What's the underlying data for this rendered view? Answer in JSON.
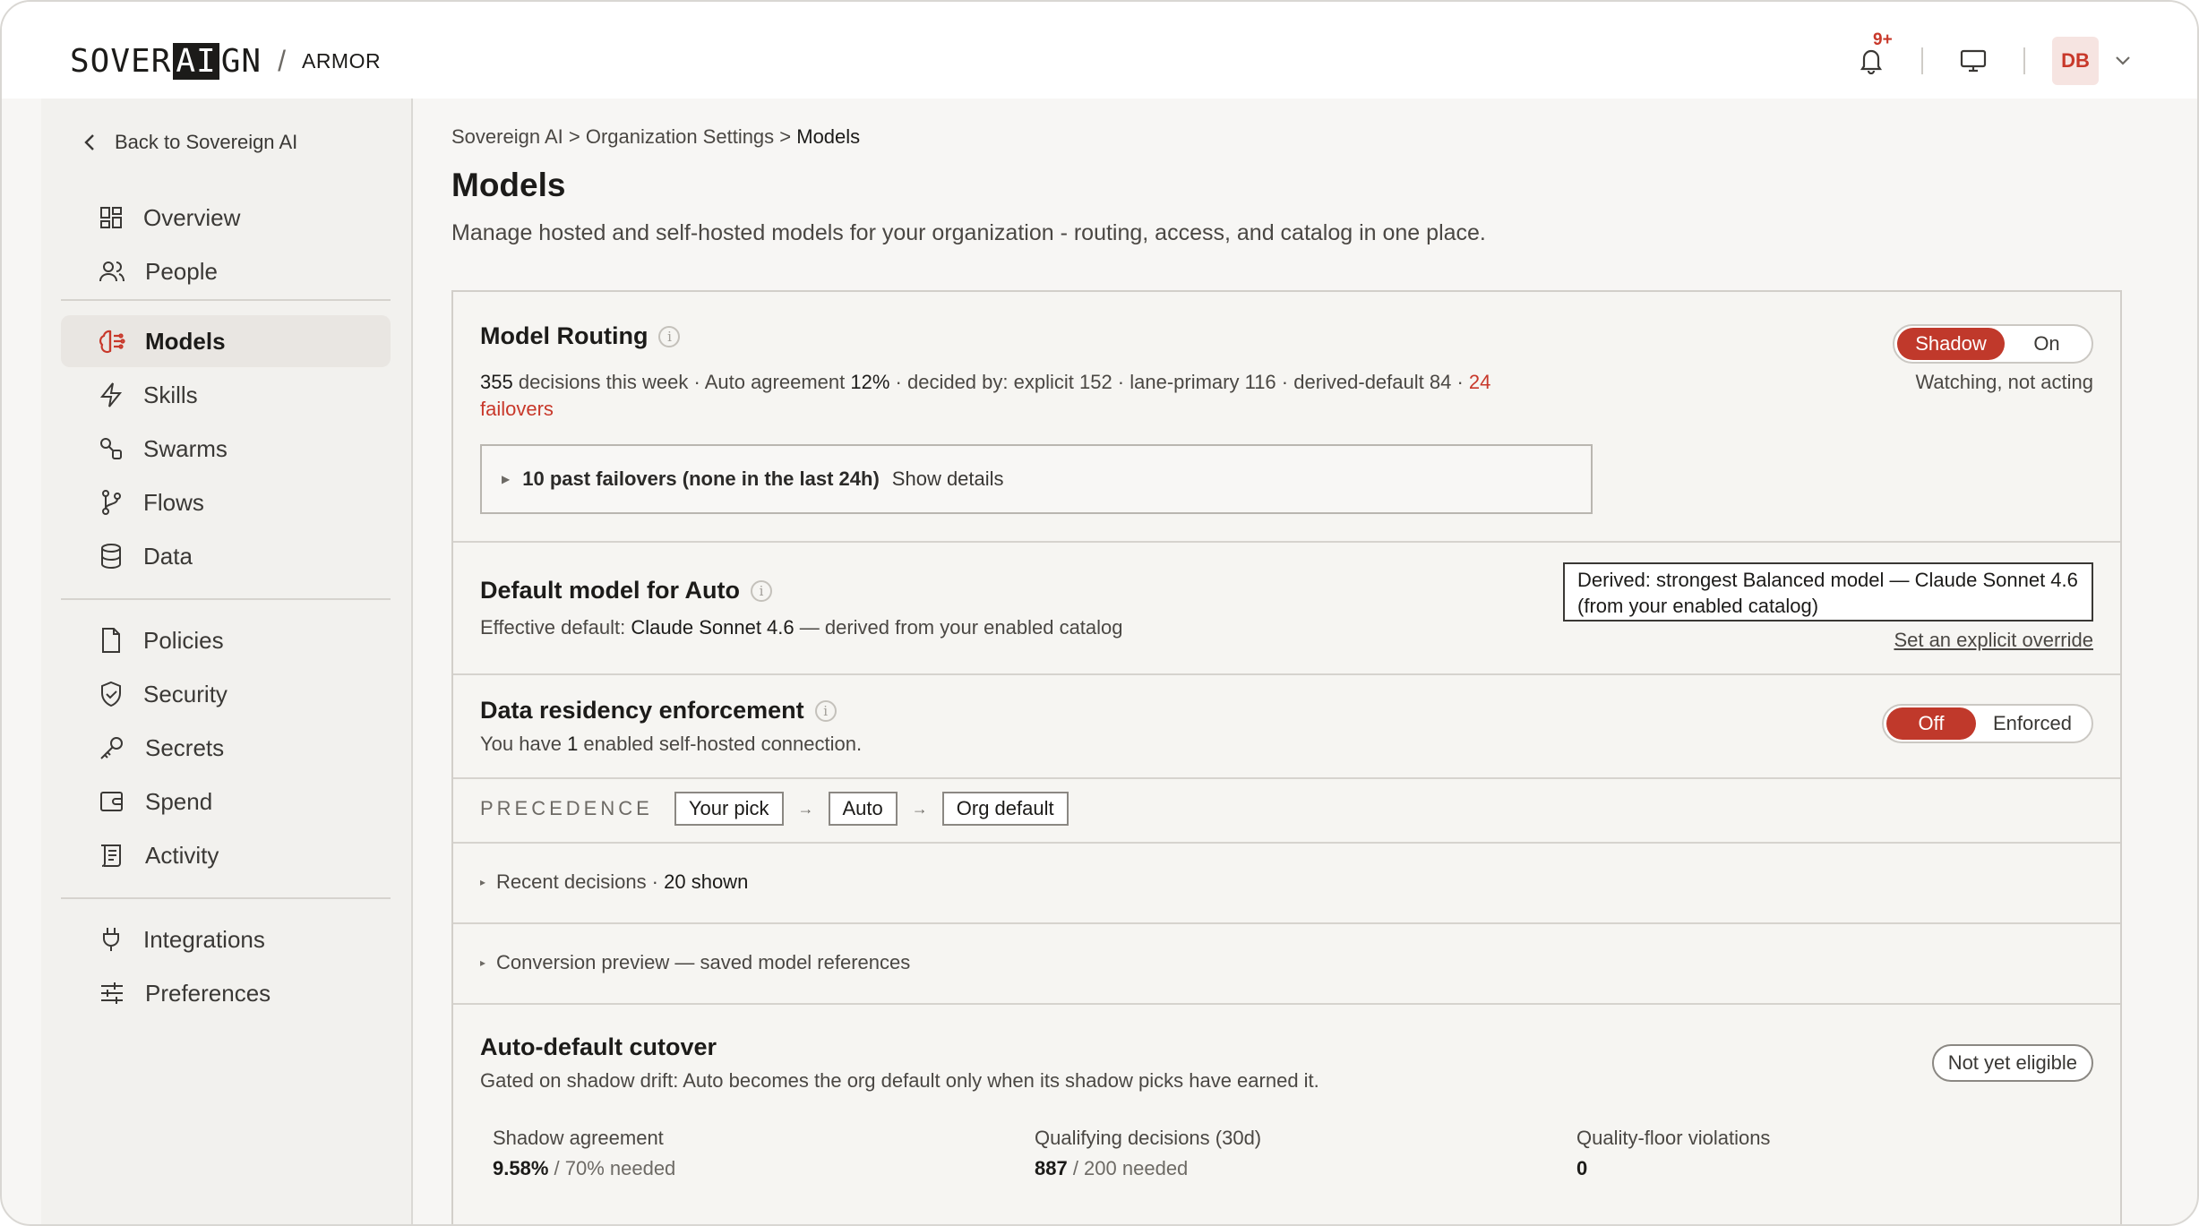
{
  "brand": {
    "logo_pre": "SOVER",
    "logo_ai": "AI",
    "logo_post": "GN",
    "separator": "/",
    "product": "ARMOR"
  },
  "header": {
    "notifications_badge": "9+",
    "avatar_initials": "DB"
  },
  "sidebar": {
    "back_label": "Back to Sovereign AI",
    "items": [
      {
        "label": "Overview",
        "icon": "grid-icon"
      },
      {
        "label": "People",
        "icon": "users-icon"
      },
      {
        "label": "Models",
        "icon": "brain-icon",
        "active": true
      },
      {
        "label": "Skills",
        "icon": "bolt-icon"
      },
      {
        "label": "Swarms",
        "icon": "nodes-icon"
      },
      {
        "label": "Flows",
        "icon": "branch-icon"
      },
      {
        "label": "Data",
        "icon": "database-icon"
      },
      {
        "label": "Policies",
        "icon": "document-icon"
      },
      {
        "label": "Security",
        "icon": "shield-icon"
      },
      {
        "label": "Secrets",
        "icon": "key-icon"
      },
      {
        "label": "Spend",
        "icon": "wallet-icon"
      },
      {
        "label": "Activity",
        "icon": "scroll-icon"
      },
      {
        "label": "Integrations",
        "icon": "plug-icon"
      },
      {
        "label": "Preferences",
        "icon": "sliders-icon"
      }
    ]
  },
  "breadcrumb": {
    "root": "Sovereign AI",
    "parent": "Organization Settings",
    "current": "Models",
    "sep": " > "
  },
  "page": {
    "title": "Models",
    "subtitle": "Manage hosted and self-hosted models for your organization - routing, access, and catalog in one place."
  },
  "routing": {
    "title": "Model Routing",
    "decisions_count": "355",
    "decisions_text": " decisions this week · Auto agreement ",
    "agreement": "12%",
    "decided_by": " · decided by: explicit 152 · lane-primary 116 · derived-default 84 · ",
    "failovers_count": "24",
    "failovers_word": "failovers",
    "toggle_shadow": "Shadow",
    "toggle_on": "On",
    "mode_caption": "Watching, not acting",
    "past_failovers": "10 past failovers (none in the last 24h)",
    "show_details": "Show details"
  },
  "default_model": {
    "title": "Default model for Auto",
    "effective_prefix": "Effective default: ",
    "effective_model": "Claude Sonnet 4.6",
    "effective_suffix": " — derived from your enabled catalog",
    "derived_text": "Derived: strongest Balanced model — Claude Sonnet 4.6 (from your enabled catalog)",
    "override_link": "Set an explicit override"
  },
  "residency": {
    "title": "Data residency enforcement",
    "text_prefix": "You have ",
    "count": "1",
    "text_suffix": " enabled self-hosted connection.",
    "toggle_off": "Off",
    "toggle_enforced": "Enforced"
  },
  "precedence": {
    "label": "PRECEDENCE",
    "chips": [
      "Your pick",
      "Auto",
      "Org default"
    ],
    "arrow": "→"
  },
  "recent": {
    "label": "Recent decisions · ",
    "count": "20 shown"
  },
  "conversion": {
    "label": "Conversion preview — saved model references"
  },
  "cutover": {
    "title": "Auto-default cutover",
    "description": "Gated on shadow drift: Auto becomes the org default only when its shadow picks have earned it.",
    "status": "Not yet eligible",
    "stats": [
      {
        "label": "Shadow agreement",
        "value": "9.58%",
        "suffix": " / 70% needed"
      },
      {
        "label": "Qualifying decisions (30d)",
        "value": "887",
        "suffix": " / 200 needed"
      },
      {
        "label": "Quality-floor violations",
        "value": "0",
        "suffix": ""
      }
    ]
  },
  "colors": {
    "accent": "#c0392b",
    "sidebar_bg": "#f2f1ee",
    "active_bg": "#e9e6e2"
  }
}
